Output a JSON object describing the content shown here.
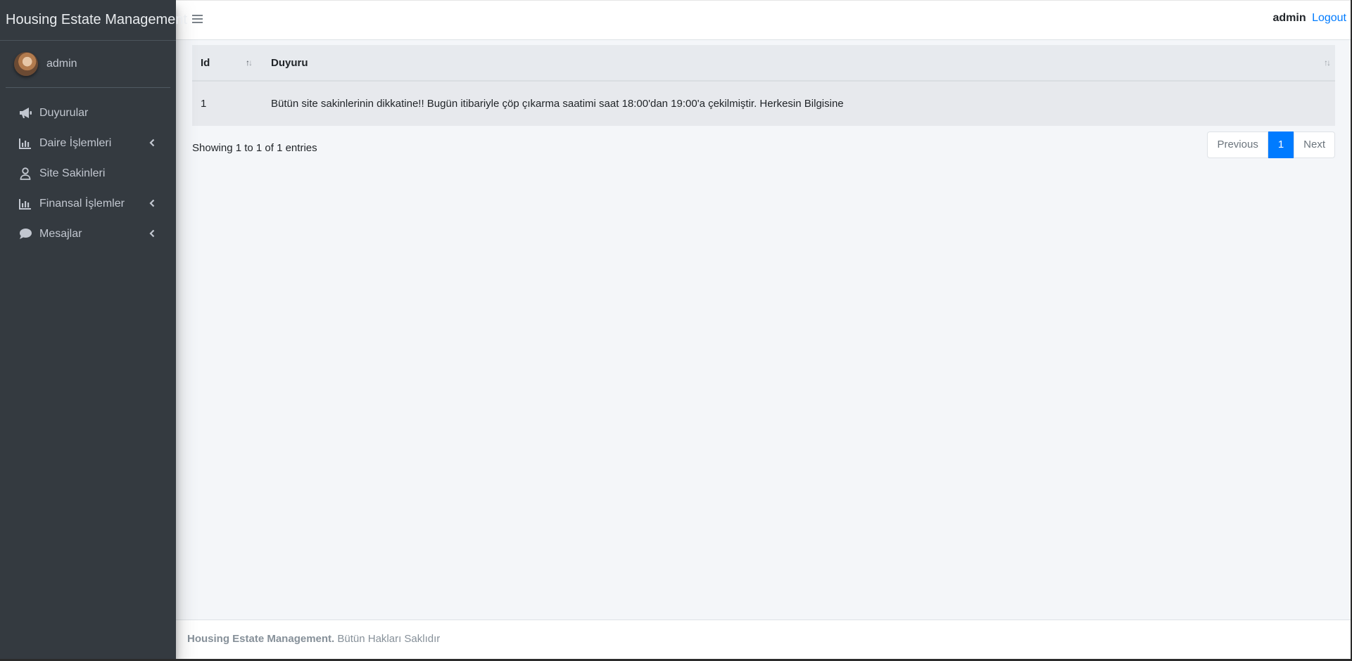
{
  "brand": {
    "title": "Housing Estate Management"
  },
  "user": {
    "name": "admin"
  },
  "sidebar": {
    "items": [
      {
        "label": "Duyurular",
        "icon": "megaphone-icon",
        "has_children": false
      },
      {
        "label": "Daire İşlemleri",
        "icon": "bar-chart-icon",
        "has_children": true
      },
      {
        "label": "Site Sakinleri",
        "icon": "user-icon",
        "has_children": false
      },
      {
        "label": "Finansal İşlemler",
        "icon": "bar-chart-icon",
        "has_children": true
      },
      {
        "label": "Mesajlar",
        "icon": "comment-icon",
        "has_children": true
      }
    ]
  },
  "header": {
    "user": "admin",
    "logout": "Logout"
  },
  "table": {
    "columns": [
      "Id",
      "Duyuru"
    ],
    "rows": [
      {
        "id": "1",
        "duyuru": "Bütün site sakinlerinin dikkatine!! Bugün itibariyle çöp çıkarma saatimi saat 18:00'dan 19:00'a  çekilmiştir. Herkesin Bilgisine"
      }
    ],
    "info": "Showing 1 to 1 of 1 entries"
  },
  "pagination": {
    "previous": "Previous",
    "current": "1",
    "next": "Next"
  },
  "footer": {
    "brand": "Housing Estate Management.",
    "rights": "Bütün Hakları Saklıdır"
  },
  "colors": {
    "sidebar_bg": "#343a40",
    "accent": "#007bff",
    "content_bg": "#f4f6f9"
  }
}
